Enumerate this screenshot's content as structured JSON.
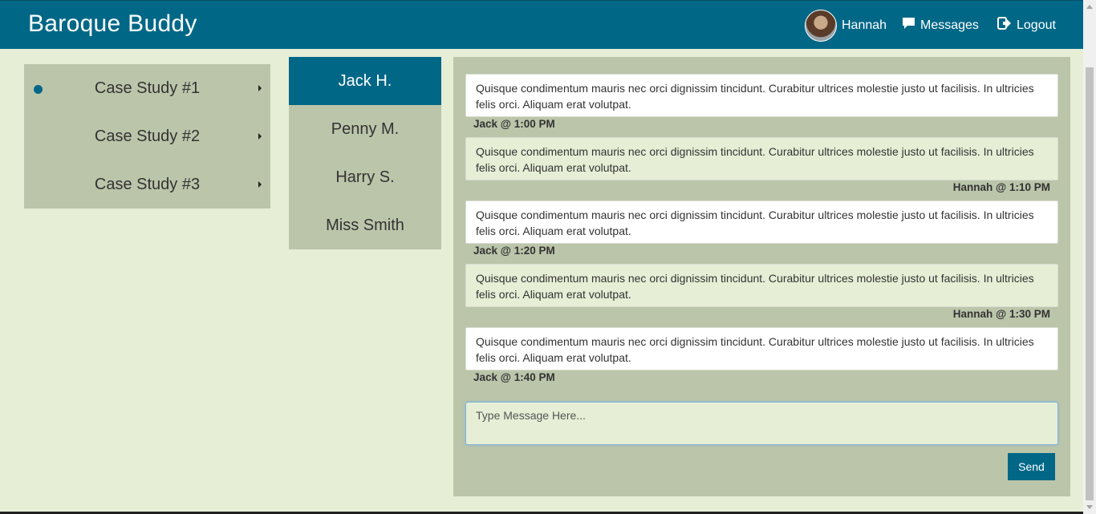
{
  "header": {
    "brand": "Baroque Buddy",
    "user_name": "Hannah",
    "messages_label": "Messages",
    "logout_label": "Logout",
    "bg_color": "#006787"
  },
  "cases": {
    "items": [
      {
        "label": "Case Study #1",
        "selected": true
      },
      {
        "label": "Case Study #2",
        "selected": false
      },
      {
        "label": "Case Study #3",
        "selected": false
      }
    ]
  },
  "people": {
    "items": [
      {
        "label": "Jack H.",
        "active": true
      },
      {
        "label": "Penny M.",
        "active": false
      },
      {
        "label": "Harry S.",
        "active": false
      },
      {
        "label": "Miss Smith",
        "active": false
      }
    ]
  },
  "chat": {
    "messages": [
      {
        "text": "Quisque condimentum mauris nec orci dignissim tincidunt. Curabitur ultrices molestie justo ut facilisis. In ultricies felis orci. Aliquam erat volutpat.",
        "meta": "Jack @ 1:00 PM",
        "from": "Jack"
      },
      {
        "text": "Quisque condimentum mauris nec orci dignissim tincidunt. Curabitur ultrices molestie justo ut facilisis. In ultricies felis orci. Aliquam erat volutpat.",
        "meta": "Hannah @ 1:10 PM",
        "from": "Hannah"
      },
      {
        "text": "Quisque condimentum mauris nec orci dignissim tincidunt. Curabitur ultrices molestie justo ut facilisis. In ultricies felis orci. Aliquam erat volutpat.",
        "meta": "Jack @ 1:20 PM",
        "from": "Jack"
      },
      {
        "text": "Quisque condimentum mauris nec orci dignissim tincidunt. Curabitur ultrices molestie justo ut facilisis. In ultricies felis orci. Aliquam erat volutpat.",
        "meta": "Hannah @ 1:30 PM",
        "from": "Hannah"
      },
      {
        "text": "Quisque condimentum mauris nec orci dignissim tincidunt. Curabitur ultrices molestie justo ut facilisis. In ultricies felis orci. Aliquam erat volutpat.",
        "meta": "Jack @ 1:40 PM",
        "from": "Jack"
      }
    ],
    "input_placeholder": "Type Message Here...",
    "input_value": "",
    "send_label": "Send"
  },
  "icons": {
    "messages": "speech-bubble-icon",
    "logout": "logout-icon",
    "bullet": "selected-dot-icon",
    "caret": "caret-right-icon"
  },
  "colors": {
    "accent": "#006787",
    "panel": "#bbc5aa",
    "page": "#e6eed6"
  }
}
